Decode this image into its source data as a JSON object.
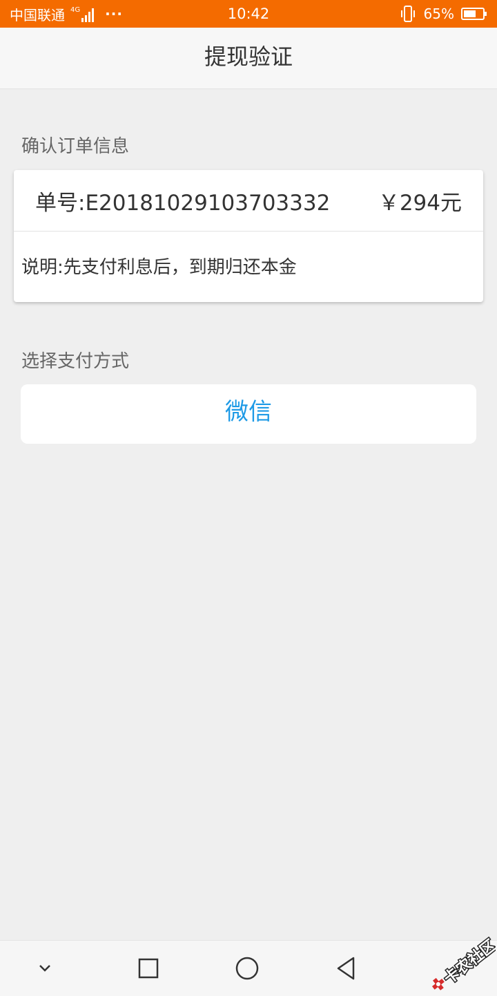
{
  "status_bar": {
    "carrier": "中国联通",
    "network": "4G",
    "more": "···",
    "time": "10:42",
    "battery_percent": "65%",
    "battery_level": 0.65,
    "color": "#f46b00"
  },
  "header": {
    "title": "提现验证"
  },
  "order_section": {
    "label": "确认订单信息",
    "order_number": "单号:E20181029103703332",
    "amount": "￥294元",
    "description": "说明:先支付利息后，到期归还本金"
  },
  "payment_section": {
    "label": "选择支付方式",
    "options": [
      {
        "label": "微信"
      }
    ],
    "accent_color": "#1e9ae6"
  },
  "nav_bar": {
    "icons": [
      "chevron-down-icon",
      "recent-apps-icon",
      "home-icon",
      "back-icon"
    ]
  },
  "watermark": {
    "text": "卡农社区"
  }
}
